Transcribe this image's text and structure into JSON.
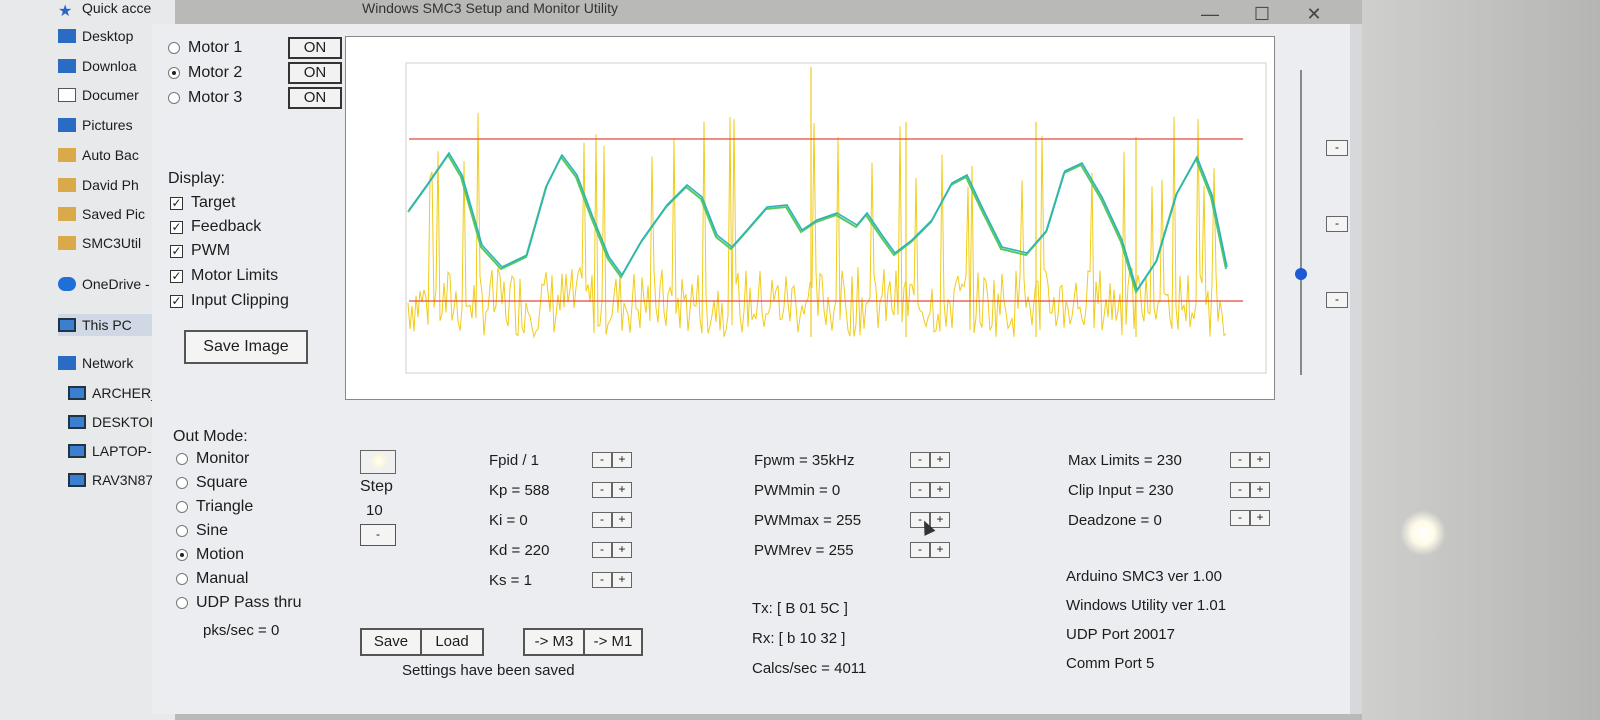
{
  "window": {
    "title": "Windows SMC3 Setup and Monitor Utility",
    "minimize": "—",
    "maximize": "☐",
    "close": "✕"
  },
  "explorer": {
    "items": [
      {
        "label": "Quick acce",
        "icon": "star-icon"
      },
      {
        "label": "Desktop",
        "icon": "desktop-icon"
      },
      {
        "label": "Downloa",
        "icon": "download-icon"
      },
      {
        "label": "Documer",
        "icon": "document-icon"
      },
      {
        "label": "Pictures",
        "icon": "pictures-icon"
      },
      {
        "label": "Auto Bac",
        "icon": "folder-icon"
      },
      {
        "label": "David Ph",
        "icon": "folder-icon"
      },
      {
        "label": "Saved Pic",
        "icon": "folder-icon"
      },
      {
        "label": "SMC3Util",
        "icon": "folder-icon"
      },
      {
        "label": "OneDrive -",
        "icon": "cloud-icon"
      },
      {
        "label": "This PC",
        "icon": "pc-icon"
      },
      {
        "label": "Network",
        "icon": "network-icon"
      },
      {
        "label": "ARCHER_",
        "icon": "pc-icon"
      },
      {
        "label": "DESKTOP",
        "icon": "pc-icon"
      },
      {
        "label": "LAPTOP-I",
        "icon": "pc-icon"
      },
      {
        "label": "RAV3N87",
        "icon": "pc-icon"
      }
    ]
  },
  "motors": [
    {
      "label": "Motor 1",
      "button": "ON",
      "selected": false
    },
    {
      "label": "Motor 2",
      "button": "ON",
      "selected": true
    },
    {
      "label": "Motor 3",
      "button": "ON",
      "selected": false
    }
  ],
  "display": {
    "heading": "Display:",
    "options": [
      "Target",
      "Feedback",
      "PWM",
      "Motor Limits",
      "Input Clipping"
    ],
    "save_image": "Save Image"
  },
  "out_mode": {
    "heading": "Out Mode:",
    "options": [
      {
        "label": "Monitor",
        "selected": false
      },
      {
        "label": "Square",
        "selected": false
      },
      {
        "label": "Triangle",
        "selected": false
      },
      {
        "label": "Sine",
        "selected": false
      },
      {
        "label": "Motion",
        "selected": true
      },
      {
        "label": "Manual",
        "selected": false
      },
      {
        "label": "UDP Pass thru",
        "selected": false
      }
    ],
    "pks": "pks/sec = 0"
  },
  "step": {
    "label": "Step",
    "value": "10",
    "minus": "-"
  },
  "pid": [
    {
      "label": "Fpid / 1"
    },
    {
      "label": "Kp = 588"
    },
    {
      "label": "Ki = 0"
    },
    {
      "label": "Kd = 220"
    },
    {
      "label": "Ks = 1"
    }
  ],
  "pwm": [
    {
      "label": "Fpwm = 35kHz"
    },
    {
      "label": "PWMmin = 0"
    },
    {
      "label": "PWMmax = 255"
    },
    {
      "label": "PWMrev = 255"
    }
  ],
  "limits": [
    {
      "label": "Max Limits = 230"
    },
    {
      "label": "Clip Input = 230"
    },
    {
      "label": "Deadzone = 0"
    }
  ],
  "pm_labels": {
    "minus": "-",
    "plus": "+"
  },
  "buttons": {
    "save": "Save",
    "load": "Load",
    "to_m3": "-> M3",
    "to_m1": "-> M1"
  },
  "status": "Settings have been saved",
  "comm": {
    "tx": "Tx: [ B 01 5C ]",
    "rx": "Rx: [ b 10 32 ]",
    "calcs": "Calcs/sec = 4011"
  },
  "info": {
    "arduino": "Arduino SMC3 ver 1.00",
    "utility": "Windows Utility ver 1.01",
    "udp": "UDP Port 20017",
    "comm_port": "Comm Port 5"
  },
  "colors": {
    "target": "#2bb3c0",
    "feedback": "#5ac85a",
    "pwm": "#f0cc1a",
    "limits": "#e04a3a"
  }
}
